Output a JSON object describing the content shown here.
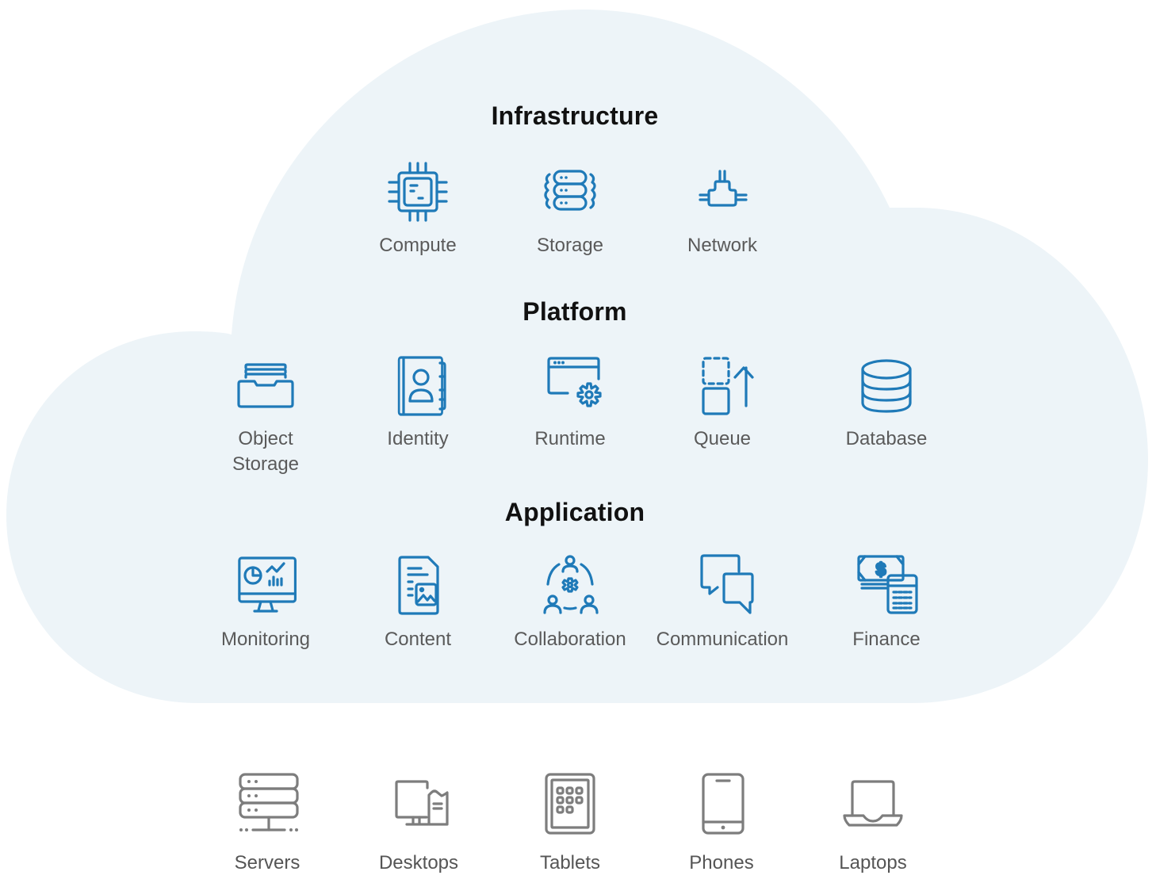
{
  "colors": {
    "cloud_fill": "#edf4f8",
    "icon_blue": "#1f7ab8",
    "icon_gray": "#7d7d7d",
    "heading": "#111111",
    "label": "#5a5a5a"
  },
  "sections": {
    "infrastructure": {
      "title": "Infrastructure",
      "items": [
        {
          "label": "Compute",
          "icon": "cpu-chip-icon"
        },
        {
          "label": "Storage",
          "icon": "server-stack-icon"
        },
        {
          "label": "Network",
          "icon": "network-connector-icon"
        }
      ]
    },
    "platform": {
      "title": "Platform",
      "items": [
        {
          "label": "Object Storage",
          "icon": "file-tray-icon"
        },
        {
          "label": "Identity",
          "icon": "address-book-icon"
        },
        {
          "label": "Runtime",
          "icon": "browser-gear-icon"
        },
        {
          "label": "Queue",
          "icon": "queue-arrow-icon"
        },
        {
          "label": "Database",
          "icon": "database-icon"
        }
      ]
    },
    "application": {
      "title": "Application",
      "items": [
        {
          "label": "Monitoring",
          "icon": "monitor-dashboard-icon"
        },
        {
          "label": "Content",
          "icon": "document-image-icon"
        },
        {
          "label": "Collaboration",
          "icon": "team-gear-icon"
        },
        {
          "label": "Communication",
          "icon": "chat-bubbles-icon"
        },
        {
          "label": "Finance",
          "icon": "money-calculator-icon"
        }
      ]
    }
  },
  "devices": {
    "items": [
      {
        "label": "Servers",
        "icon": "server-rack-icon"
      },
      {
        "label": "Desktops",
        "icon": "desktop-tower-icon"
      },
      {
        "label": "Tablets",
        "icon": "tablet-icon"
      },
      {
        "label": "Phones",
        "icon": "phone-icon"
      },
      {
        "label": "Laptops",
        "icon": "laptop-icon"
      }
    ]
  }
}
